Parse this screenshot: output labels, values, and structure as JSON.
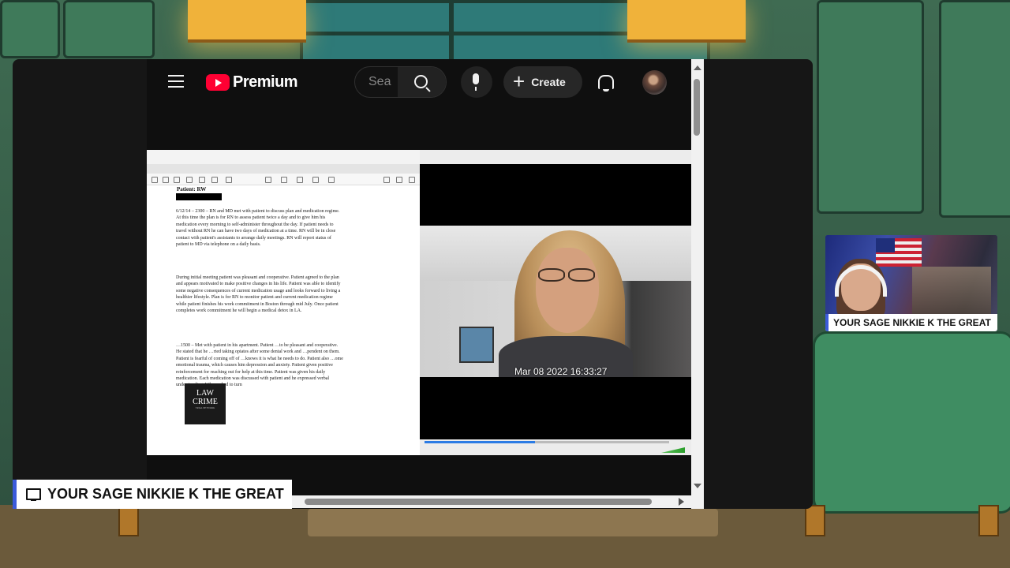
{
  "youtube": {
    "brand": "Premium",
    "search_placeholder": "Sea",
    "create_label": "Create"
  },
  "document": {
    "heading": "Patient: RW",
    "paragraphs": [
      "6/12/14 – 2300 – RN and MD met with patient to discuss plan and medication regime. At this time the plan is for RN to assess patient twice a day and to give him his medication every morning to self-administer throughout the day. If patient needs to travel without RN he can have two days of medication at a time. RN will be in close contact with patient's assistants to arrange daily meetings. RN will report status of patient to MD via telephone on a daily basis.",
      "During initial meeting patient was pleasant and cooperative. Patient agreed to the plan and appears motivated to make positive changes in his life. Patient was able to identify some negative consequences of current medication usage and looks forward to living a healthier lifestyle. Plan is for RN to monitor patient and current medication regime while patient finishes his work commitment in Boston through mid July. Once patient completes work commitment he will begin a medical detox in LA.",
      "…1500 – Met with patient in his apartment. Patient …to be pleasant and cooperative. He stated that he …rted taking opiates after some dental work and …pendent on them. Patient is fearful of coming off of …knows it is what he needs to do. Patient also …ome emotional trauma, which causes him depression and anxiety. Patient given positive reinforcement for reaching out for help at this time. Patient was given his daily medication. Each medication was discussed with patient and he expressed verbal understanding. When asked to turn"
    ],
    "logo_line1": "LAW",
    "logo_line2": "CRIME",
    "logo_sub": "TRIAL NETWORK"
  },
  "video": {
    "timestamp": "Mar 08 2022 16:33:27",
    "progress": 0.45
  },
  "overlays": {
    "lower_third_label": "YOUR SAGE NIKKIE K THE GREAT",
    "webcam_name": "YOUR SAGE NIKKIE K THE GREAT"
  }
}
